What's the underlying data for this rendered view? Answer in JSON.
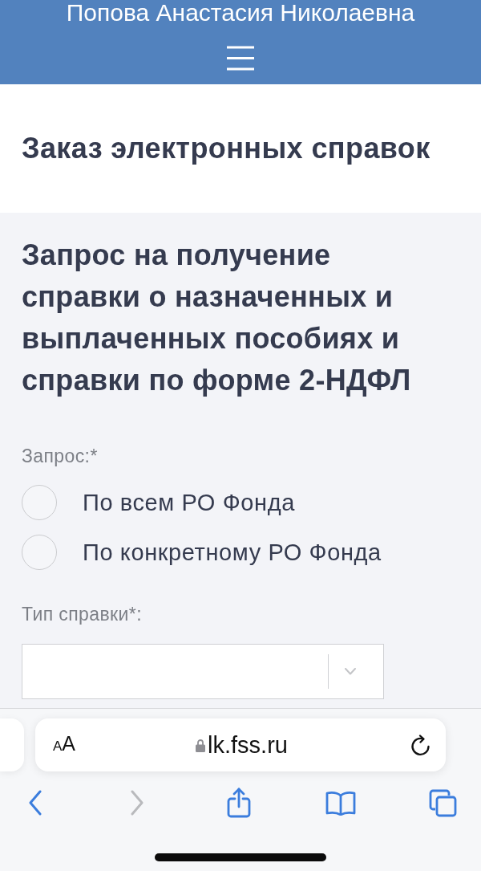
{
  "header": {
    "user_name": "Попова Анастасия Николаевна"
  },
  "page_title": "Заказ электронных справок",
  "form": {
    "heading": "Запрос на получение справки о назначенных и выплаченных пособиях и справки по форме 2-НДФЛ",
    "request_label": "Запрос:*",
    "request_options": [
      {
        "label": "По всем РО Фонда",
        "selected": false
      },
      {
        "label": "По конкретному РО Фонда",
        "selected": false
      }
    ],
    "type_label": "Тип справки*:"
  },
  "browser": {
    "text_size_button": "AA",
    "url": "lk.fss.ru",
    "toolbar": [
      {
        "kind": "back",
        "disabled": false
      },
      {
        "kind": "forward",
        "disabled": true
      },
      {
        "kind": "share",
        "disabled": false
      },
      {
        "kind": "bookmarks",
        "disabled": false
      },
      {
        "kind": "tabs",
        "disabled": false
      }
    ]
  }
}
